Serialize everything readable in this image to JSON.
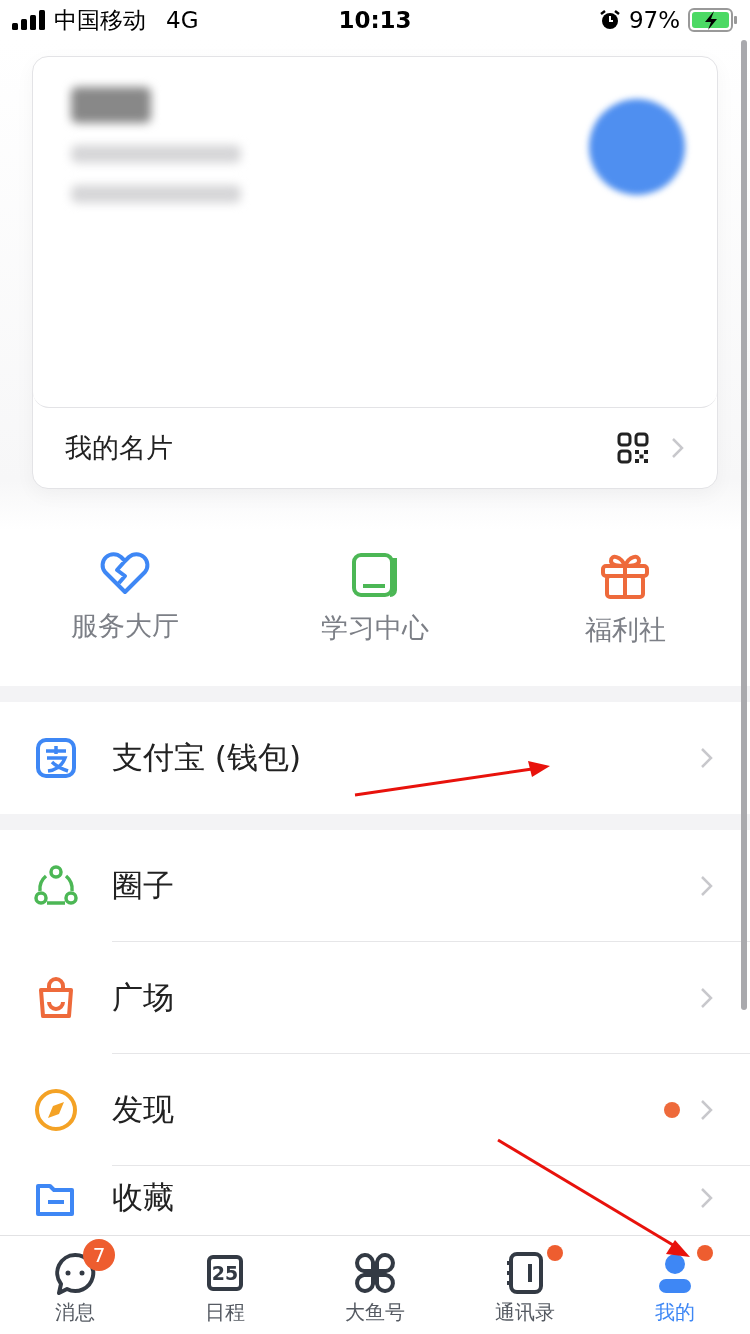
{
  "status_bar": {
    "carrier": "中国移动",
    "network": "4G",
    "time": "10:13",
    "battery": "97%"
  },
  "profile_card": {
    "footer_label": "我的名片"
  },
  "shortcuts": [
    {
      "label": "服务大厅",
      "kind": "heart"
    },
    {
      "label": "学习中心",
      "kind": "book"
    },
    {
      "label": "福利社",
      "kind": "gift"
    }
  ],
  "wallet_row": {
    "label": "支付宝 (钱包)"
  },
  "menu_rows": [
    {
      "label": "圈子",
      "kind": "circle",
      "dot": false
    },
    {
      "label": "广场",
      "kind": "bag",
      "dot": false
    },
    {
      "label": "发现",
      "kind": "compass",
      "dot": true
    },
    {
      "label": "收藏",
      "kind": "folder",
      "dot": false
    }
  ],
  "tabs": [
    {
      "label": "消息",
      "kind": "chat",
      "badge": "7",
      "dot": false,
      "selected": false
    },
    {
      "label": "日程",
      "kind": "calendar",
      "icon_text": "25",
      "dot": false,
      "selected": false
    },
    {
      "label": "大鱼号",
      "kind": "petals",
      "dot": false,
      "selected": false
    },
    {
      "label": "通讯录",
      "kind": "contacts",
      "dot": true,
      "selected": false
    },
    {
      "label": "我的",
      "kind": "person",
      "dot": true,
      "selected": true
    }
  ]
}
